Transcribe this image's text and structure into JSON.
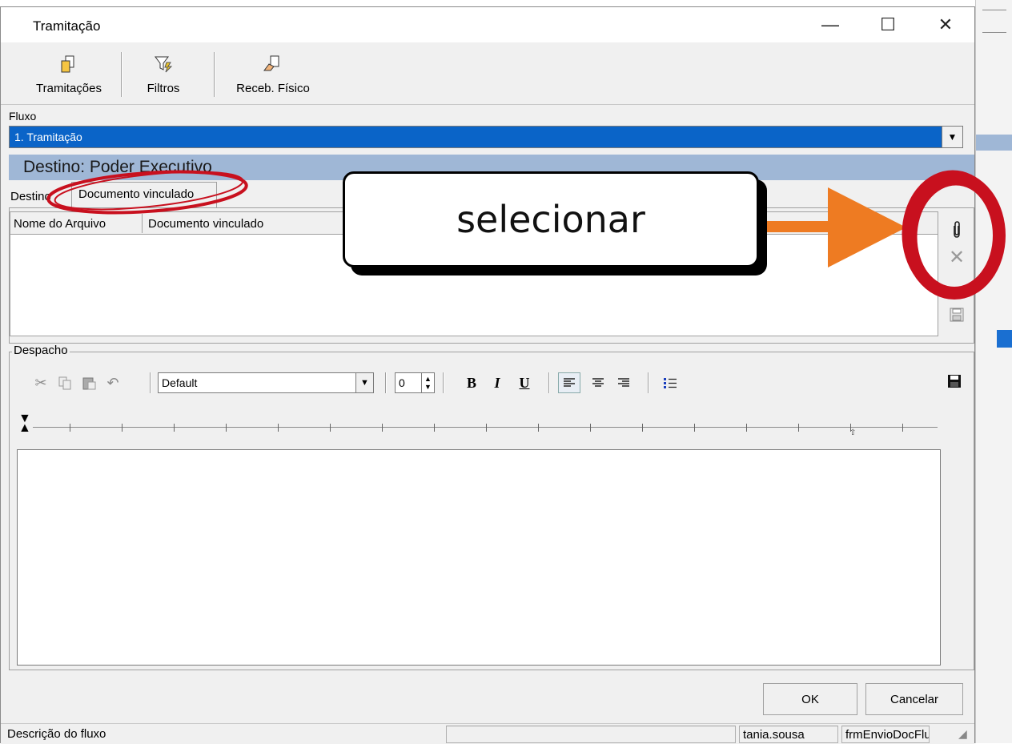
{
  "window": {
    "title": "Tramitação",
    "controls": {
      "minimize": "—",
      "maximize": "☐",
      "close": "✕"
    }
  },
  "toolbar": {
    "tramitacoes": "Tramitações",
    "filtros": "Filtros",
    "receb_fisico": "Receb. Físico"
  },
  "fluxo": {
    "label": "Fluxo",
    "selected": "1. Tramitação"
  },
  "destino_header": "Destino: Poder Executivo",
  "tabs": {
    "destino": "Destino",
    "documento_vinculado": "Documento vinculado"
  },
  "grid": {
    "columns": [
      "Nome do Arquivo",
      "Documento vinculado"
    ]
  },
  "despacho": {
    "label": "Despacho",
    "font": "Default",
    "size": "0",
    "bold": "B",
    "italic": "I",
    "underline": "U"
  },
  "buttons": {
    "ok": "OK",
    "cancel": "Cancelar"
  },
  "statusbar": {
    "description": "Descrição do fluxo",
    "empty": "",
    "user": "tania.sousa",
    "form": "frmEnvioDocFlu"
  },
  "annotation": {
    "text": "selecionar",
    "arrow_color": "#ee7b22",
    "circle_color": "#c8101e"
  },
  "colors": {
    "selection_blue": "#0a64c8",
    "header_blue": "#9fb7d6"
  }
}
